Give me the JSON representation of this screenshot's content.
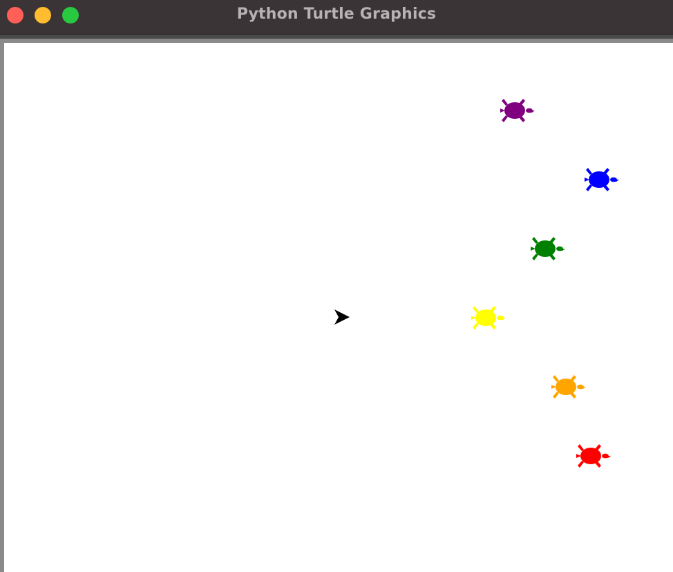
{
  "window": {
    "title": "Python Turtle Graphics",
    "buttons": {
      "close_color": "#ff5f57",
      "minimize_color": "#febc2e",
      "zoom_color": "#28c840"
    }
  },
  "canvas": {
    "background": "#ffffff"
  },
  "pen": {
    "shape": "classic arrow",
    "icon": "arrow-cursor-icon",
    "color": "#000000"
  },
  "turtles": [
    {
      "name": "turtle-purple",
      "color": "#800080"
    },
    {
      "name": "turtle-blue",
      "color": "#0000ff"
    },
    {
      "name": "turtle-green",
      "color": "#008000"
    },
    {
      "name": "turtle-yellow",
      "color": "#ffff00"
    },
    {
      "name": "turtle-orange",
      "color": "#ffa500"
    },
    {
      "name": "turtle-red",
      "color": "#ff0000"
    }
  ]
}
